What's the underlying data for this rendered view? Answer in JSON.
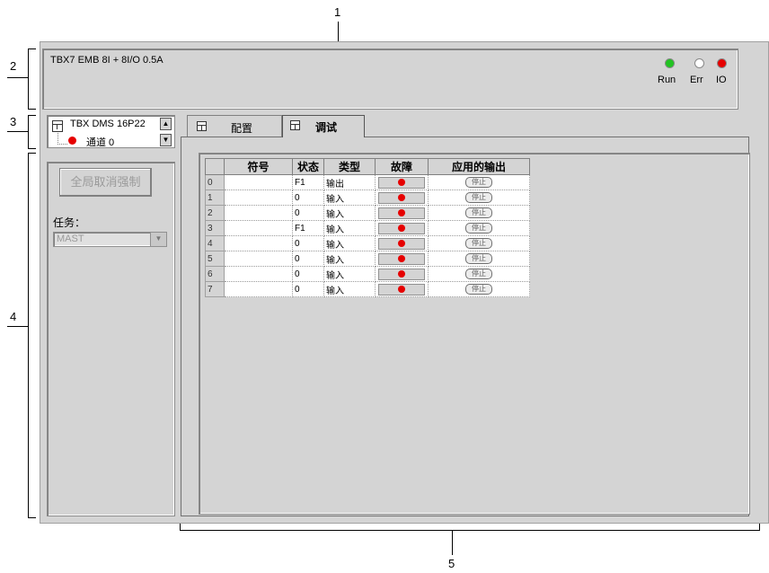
{
  "callouts": {
    "c1": "1",
    "c2": "2",
    "c3": "3",
    "c4": "4",
    "c5": "5"
  },
  "header": {
    "title": "TBX7 EMB 8I + 8I/O 0.5A",
    "leds": [
      {
        "label": "Run",
        "color": "#22c322"
      },
      {
        "label": "Err",
        "color": "#ffffff"
      },
      {
        "label": "IO",
        "color": "#e60000"
      }
    ]
  },
  "module": {
    "name": "TBX DMS 16P22",
    "channel": "通道 0",
    "channel_led_color": "#e60000"
  },
  "left_panel": {
    "unforce_button": "全局取消强制",
    "task_label": "任务：",
    "task_value": "MAST"
  },
  "tabs": [
    {
      "label": "配置",
      "active": false
    },
    {
      "label": "调试",
      "active": true
    }
  ],
  "table": {
    "headers": [
      "符号",
      "状态",
      "类型",
      "故障",
      "应用的输出"
    ],
    "rows": [
      {
        "index": "0",
        "symbol": "",
        "state": "F1",
        "type": "输出",
        "output": "停止"
      },
      {
        "index": "1",
        "symbol": "",
        "state": "0",
        "type": "输入",
        "output": "停止"
      },
      {
        "index": "2",
        "symbol": "",
        "state": "0",
        "type": "输入",
        "output": "停止"
      },
      {
        "index": "3",
        "symbol": "",
        "state": "F1",
        "type": "输入",
        "output": "停止"
      },
      {
        "index": "4",
        "symbol": "",
        "state": "0",
        "type": "输入",
        "output": "停止"
      },
      {
        "index": "5",
        "symbol": "",
        "state": "0",
        "type": "输入",
        "output": "停止"
      },
      {
        "index": "6",
        "symbol": "",
        "state": "0",
        "type": "输入",
        "output": "停止"
      },
      {
        "index": "7",
        "symbol": "",
        "state": "0",
        "type": "输入",
        "output": "停止"
      }
    ]
  },
  "colors": {
    "fault_led": "#e60000",
    "panel_bg": "#d4d4d4"
  }
}
